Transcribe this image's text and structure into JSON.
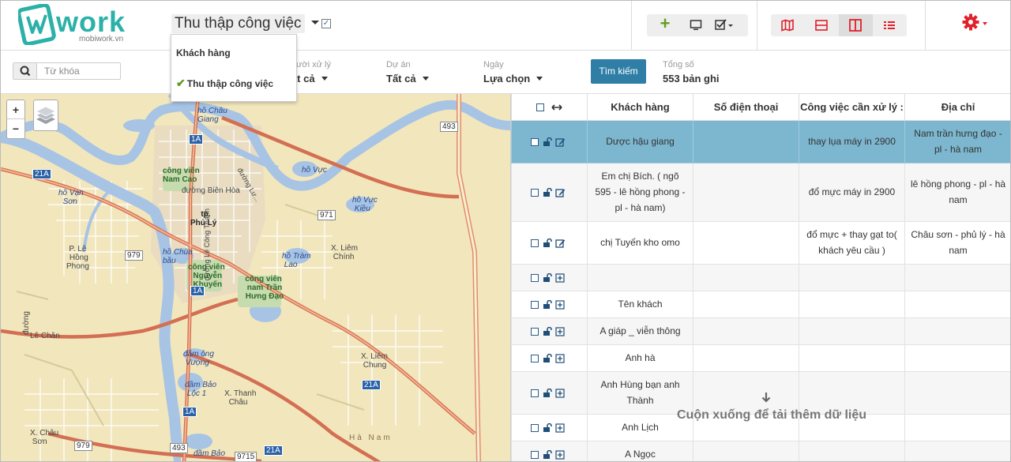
{
  "header": {
    "logo_text": "work",
    "logo_sub": "mobiwork.vn",
    "view_title": "Thu thập công việc",
    "view_menu": [
      {
        "label": "Khách hàng",
        "selected": false
      },
      {
        "label": "Thu thập công việc",
        "selected": true
      }
    ],
    "toolbar_icons": [
      "plus-icon",
      "monitor-icon",
      "checklist-icon"
    ],
    "view_icons": [
      "map-icon",
      "split-horizontal-icon",
      "split-vertical-icon",
      "list-icon"
    ],
    "settings_icon": "gear-icon",
    "accent": "#e0202a"
  },
  "filters": {
    "search_placeholder": "Từ khóa",
    "assignee": {
      "label": "Người xử lý",
      "value": "Tất cả"
    },
    "project": {
      "label": "Dự án",
      "value": "Tất cả"
    },
    "date": {
      "label": "Ngày",
      "value": "Lựa chọn"
    },
    "search_button": "Tìm kiếm",
    "total_label": "Tổng số",
    "total_value": "553 bản ghi",
    "button_color": "#2e7ea6"
  },
  "map": {
    "labels": {
      "ho_chau_giang": [
        "hồ Châu",
        "Giang"
      ],
      "cong_vien_nam_cao": [
        "công viên",
        "Nam Cao"
      ],
      "duong_bien_hoa": "đường Biên Hòa",
      "ho_vuc": "hồ Vực",
      "ho_van_son": [
        "hồ Vạn",
        "Sơn"
      ],
      "tp_phu_ly": [
        "tp.",
        "Phủ Lý"
      ],
      "ho_vuc_kieu": [
        "hồ Vực",
        "Kiều"
      ],
      "p_le_hong_phong": [
        "P. Lê",
        "Hồng",
        "Phong"
      ],
      "ho_chua_bau": [
        "hồ Chùa",
        "bầu"
      ],
      "x_liem_chinh": [
        "X. Liêm",
        "Chính"
      ],
      "ho_tram_lao": [
        "hồ Tràm",
        "Lao"
      ],
      "cong_vien_nguyen_khuyen": [
        "công viên",
        "Nguyễn",
        "Khuyến"
      ],
      "cong_vien_nam_tran_hung_dao": [
        "công viên",
        "nam Trần",
        "Hưng Đạo"
      ],
      "le_chan": "Lê Chân",
      "dam_ong_vuong": [
        "đầm ông",
        "Vượng"
      ],
      "x_liem_chung": [
        "X. Liêm",
        "Chung"
      ],
      "dam_bao_loc_1": [
        "đầm Bảo",
        "Lộc 1"
      ],
      "x_thanh_chau": [
        "X. Thanh",
        "Châu"
      ],
      "x_chau_son": [
        "X. Châu",
        "Sơn"
      ],
      "dam_bao_loc_2": "đầm Bảo",
      "ha_nam": "Hà Nam",
      "duong": "đường",
      "duong_le_cong_thanh": "đường Lê Công Thanh",
      "duong_lu_van": "đường Lư..."
    },
    "shields": [
      "1A",
      "493",
      "21A",
      "971",
      "979",
      "1A",
      "21A",
      "1A",
      "979",
      "493",
      "9715",
      "21A"
    ]
  },
  "table": {
    "select_all_icon": "checkbox-icon",
    "resize_icon": "arrows-horizontal-icon",
    "columns": [
      "Khách hàng",
      "Số điện thoại",
      "Công việc cần xử lý :",
      "Địa chỉ"
    ],
    "rows": [
      {
        "customer": "Dược hậu giang",
        "phone": "",
        "task": "thay lụa máy in 2900",
        "address": "Nam trần hưng đạo - pl - hà nam",
        "action": "edit",
        "selected": true
      },
      {
        "customer": "Em chị Bích. ( ngõ 595 - lê hồng phong - pl - hà nam)",
        "phone": "",
        "task": "đổ mực máy in 2900",
        "address": "lê hồng phong - pl - hà nam",
        "action": "edit",
        "selected": false
      },
      {
        "customer": "chị Tuyến kho omo",
        "phone": "",
        "task": "đổ mực + thay gạt to( khách yêu cầu )",
        "address": "Châu sơn - phủ lý - hà nam",
        "action": "edit",
        "selected": false
      },
      {
        "customer": "",
        "phone": "",
        "task": "",
        "address": "",
        "action": "add",
        "selected": false
      },
      {
        "customer": "Tên khách",
        "phone": "",
        "task": "",
        "address": "",
        "action": "add",
        "selected": false
      },
      {
        "customer": "A giáp _ viễn thông",
        "phone": "",
        "task": "",
        "address": "",
        "action": "add",
        "selected": false
      },
      {
        "customer": "Anh hà",
        "phone": "",
        "task": "",
        "address": "",
        "action": "add",
        "selected": false
      },
      {
        "customer": "Anh Hùng bạn anh Thành",
        "phone": "",
        "task": "",
        "address": "",
        "action": "add",
        "selected": false
      },
      {
        "customer": "Anh Lịch",
        "phone": "",
        "task": "",
        "address": "",
        "action": "add",
        "selected": false
      },
      {
        "customer": "A Ngọc",
        "phone": "",
        "task": "",
        "address": "",
        "action": "add",
        "selected": false
      }
    ],
    "load_more": "Cuộn xuống để tải thêm dữ liệu",
    "selected_row_color": "#7db7cf"
  }
}
